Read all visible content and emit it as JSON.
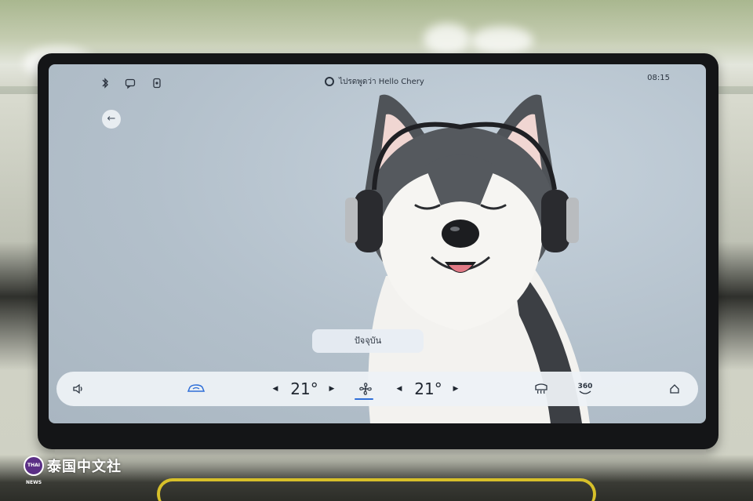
{
  "status_bar": {
    "voice_hint": "ไปรดพูดว่า Hello Chery",
    "time": "08:15",
    "icons": [
      "bluetooth-icon",
      "message-icon",
      "device-icon",
      "microphone-icon"
    ]
  },
  "main": {
    "back_icon": "arrow-left-icon",
    "current_button_label": "ปัจจุบัน",
    "illustration": "husky-with-headphones"
  },
  "climate_bar": {
    "volume_icon": "speaker-icon",
    "car_icon": "car-air-circulation-icon",
    "left_temp": "21°",
    "fan_icon": "fan-icon",
    "right_temp": "21°",
    "defrost_icon": "rear-defrost-icon",
    "view_360_label": "360",
    "home_icon": "home-icon",
    "arrow_left": "◀",
    "arrow_right": "▶"
  },
  "watermark": {
    "badge": "THAI NEWS",
    "text": "泰国中文社"
  },
  "colors": {
    "screen_bg": "#b3c0cb",
    "bar_bg": "#edf1f6",
    "accent_blue": "#2f6fd8",
    "watermark_purple": "#5b2f86"
  }
}
